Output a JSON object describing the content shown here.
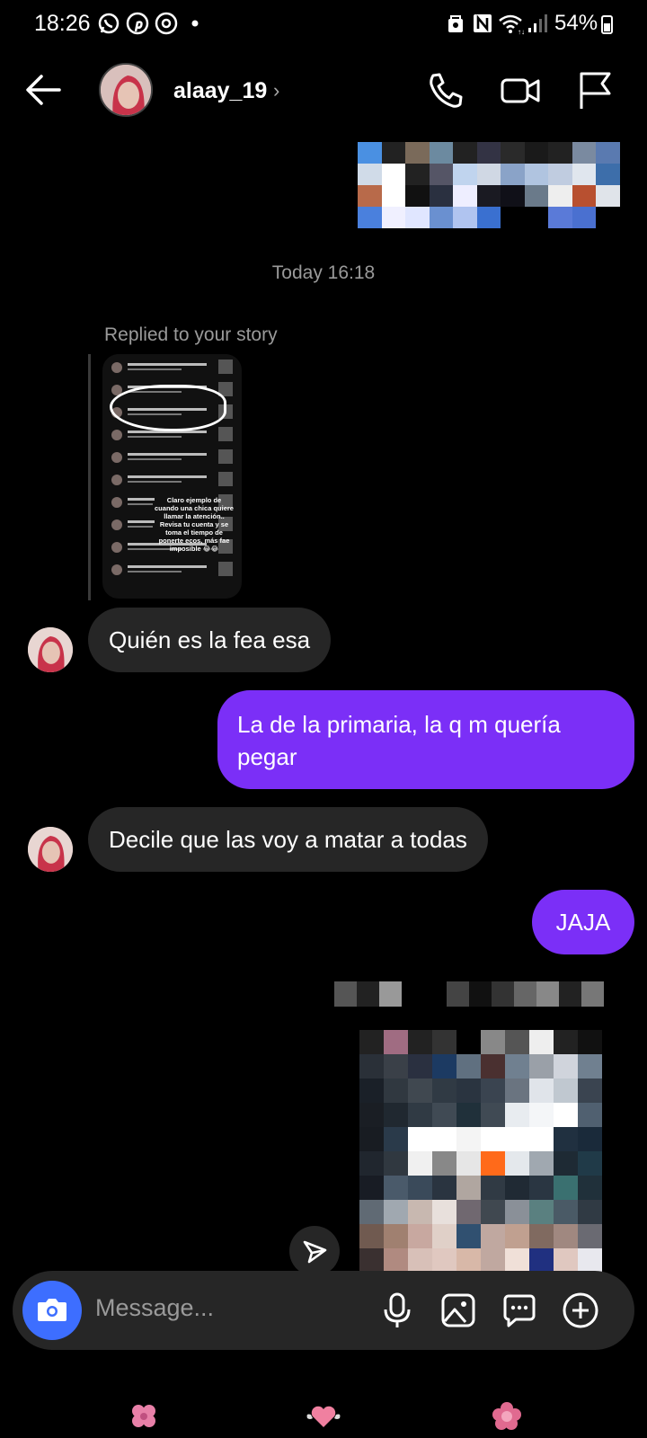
{
  "status_bar": {
    "time": "18:26",
    "battery": "54%",
    "app_icons": [
      "whatsapp-icon",
      "pinterest-icon",
      "threads-icon",
      "dot-icon"
    ],
    "system_icons": [
      "lock-recycle-icon",
      "nfc-icon",
      "wifi-icon",
      "signal-icon",
      "battery-icon"
    ]
  },
  "header": {
    "username": "alaay_19",
    "chevron": "›"
  },
  "conversation": {
    "timestamp": "Today 16:18",
    "replied_label": "Replied to your story",
    "story_caption": "Claro ejemplo de cuando una chica quiere llamar la atención.. Revisa tu cuenta y se toma el tiempo de ponerte ecos, más fae imposible 😂😂",
    "messages": [
      {
        "direction": "in",
        "text": "Quién es la fea esa"
      },
      {
        "direction": "out",
        "text": "La de la primaria, la q m quería pegar"
      },
      {
        "direction": "in",
        "text": "Decile que las voy a matar a todas"
      },
      {
        "direction": "out",
        "text": "JAJA"
      }
    ]
  },
  "composer": {
    "placeholder": "Message..."
  },
  "colors": {
    "background": "#000000",
    "incoming_bubble": "#262626",
    "outgoing_bubble": "#7b2ff7",
    "camera_button": "#3d6eff",
    "secondary_text": "#9a9a9a"
  }
}
